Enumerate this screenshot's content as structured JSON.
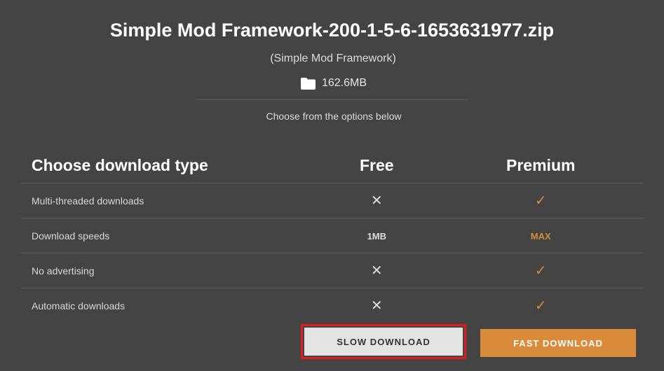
{
  "file": {
    "name": "Simple Mod Framework-200-1-5-6-1653631977.zip",
    "mod_name": "(Simple Mod Framework)",
    "size": "162.6MB",
    "folder_icon": "folder-icon"
  },
  "prompt": "Choose from the options below",
  "table": {
    "header": {
      "label": "Choose download type",
      "free": "Free",
      "premium": "Premium"
    },
    "rows": [
      {
        "label": "Multi-threaded downloads",
        "free": "✕",
        "premium": "✓"
      },
      {
        "label": "Download speeds",
        "free": "1MB",
        "premium": "MAX"
      },
      {
        "label": "No advertising",
        "free": "✕",
        "premium": "✓"
      },
      {
        "label": "Automatic downloads",
        "free": "✕",
        "premium": "✓"
      }
    ]
  },
  "buttons": {
    "slow": "SLOW DOWNLOAD",
    "fast": "FAST DOWNLOAD"
  },
  "colors": {
    "background": "#444444",
    "accent": "#d98b3a",
    "highlight_border": "#e21b23"
  }
}
